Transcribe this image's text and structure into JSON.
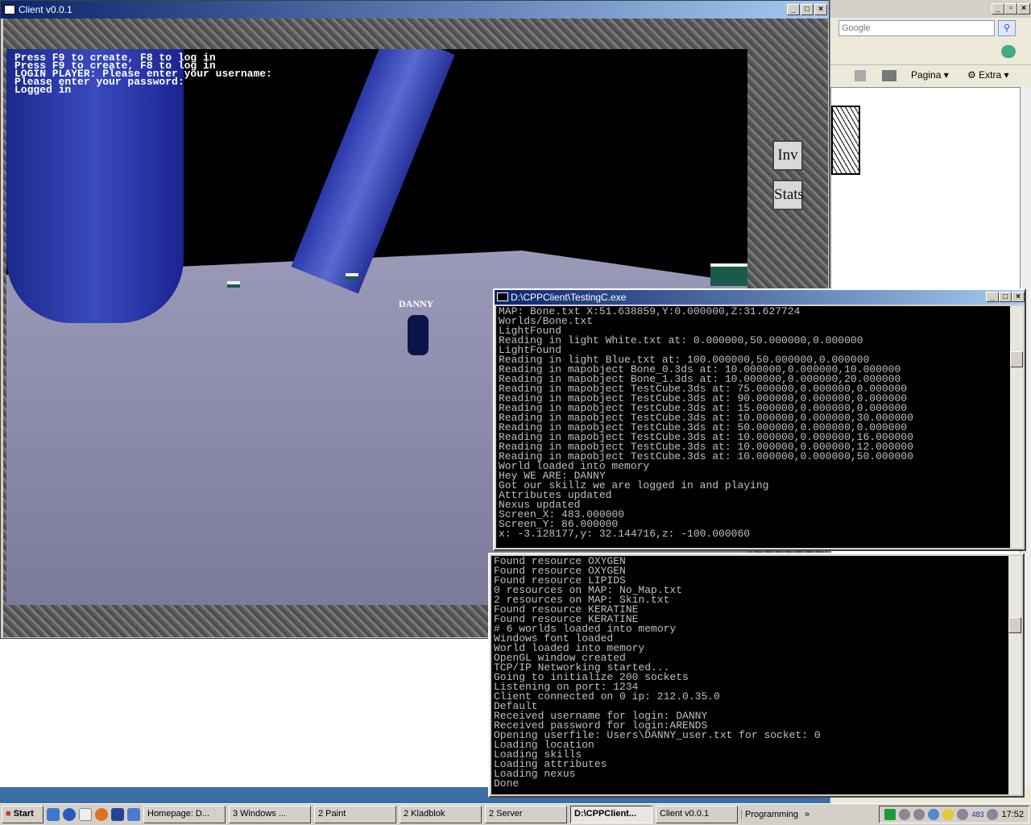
{
  "ie": {
    "search_placeholder": "Google",
    "search_icon": "magnifier-icon",
    "cmd": {
      "page": "Pagina",
      "extra": "Extra"
    }
  },
  "client": {
    "title": "Client v0.0.1",
    "messages": [
      "Press F9 to create, F8 to log in",
      "Press F9 to create, F8 to log in",
      "LOGIN PLAYER: Please enter your username:",
      "Please enter your password:",
      "Logged in"
    ],
    "player_name": "DANNY",
    "inv_label": "Inv",
    "stats_label": "Stats"
  },
  "console_client": {
    "title": "D:\\CPPClient\\TestingC.exe",
    "lines": [
      "MAP: Bone.txt X:51.638859,Y:0.000000,Z:31.627724",
      "Worlds/Bone.txt",
      "LightFound",
      "Reading in light White.txt at: 0.000000,50.000000,0.000000",
      "LightFound",
      "Reading in light Blue.txt at: 100.000000,50.000000,0.000000",
      "Reading in mapobject Bone_0.3ds at: 10.000000,0.000000,10.000000",
      "Reading in mapobject Bone_1.3ds at: 10.000000,0.000000,20.000000",
      "Reading in mapobject TestCube.3ds at: 75.000000,0.000000,0.000000",
      "Reading in mapobject TestCube.3ds at: 90.000000,0.000000,0.000000",
      "Reading in mapobject TestCube.3ds at: 15.000000,0.000000,0.000000",
      "Reading in mapobject TestCube.3ds at: 10.000000,0.000000,30.000000",
      "Reading in mapobject TestCube.3ds at: 50.000000,0.000000,0.000000",
      "Reading in mapobject TestCube.3ds at: 10.000000,0.000000,16.000000",
      "Reading in mapobject TestCube.3ds at: 10.000000,0.000000,12.000000",
      "Reading in mapobject TestCube.3ds at: 10.000000,0.000000,50.000000",
      "World loaded into memory",
      "Hey WE ARE: DANNY",
      "Got our skillz we are logged in and playing",
      "Attributes updated",
      "Nexus updated",
      "Screen_X: 483.000000",
      "Screen_Y: 86.000000",
      "x: -3.128177,y: 32.144716,z: -100.000060"
    ]
  },
  "console_server": {
    "lines": [
      "Found resource OXYGEN",
      "Found resource OXYGEN",
      "Found resource LIPIDS",
      "0 resources on MAP: No_Map.txt",
      "2 resources on MAP: Skin.txt",
      "Found resource KERATINE",
      "Found resource KERATINE",
      "# 6 worlds loaded into memory",
      "Windows font loaded",
      "World loaded into memory",
      "OpenGL window created",
      "TCP/IP Networking started...",
      "Going to initialize 200 sockets",
      "Listening on port: 1234",
      "Client connected on 0 ip: 212.0.35.0",
      "Default",
      "Received username for login: DANNY",
      "Received password for login:ARENDS",
      "Opening userfile: Users\\DANNY_user.txt for socket: 0",
      "Loading location",
      "Loading skills",
      "Loading attributes",
      "Loading nexus",
      "Done"
    ]
  },
  "taskbar": {
    "start": "Start",
    "buttons": [
      "Homepage: D...",
      "3 Windows ...",
      "2 Paint",
      "2 Kladblok",
      "2 Server",
      "D:\\CPPClient...",
      "Client v0.0.1"
    ],
    "toolbar": "Programming",
    "tray_count": "483",
    "clock": "17:52"
  },
  "colors": {
    "title_active": "#0a246a",
    "taskbar": "#d4d0c8"
  }
}
